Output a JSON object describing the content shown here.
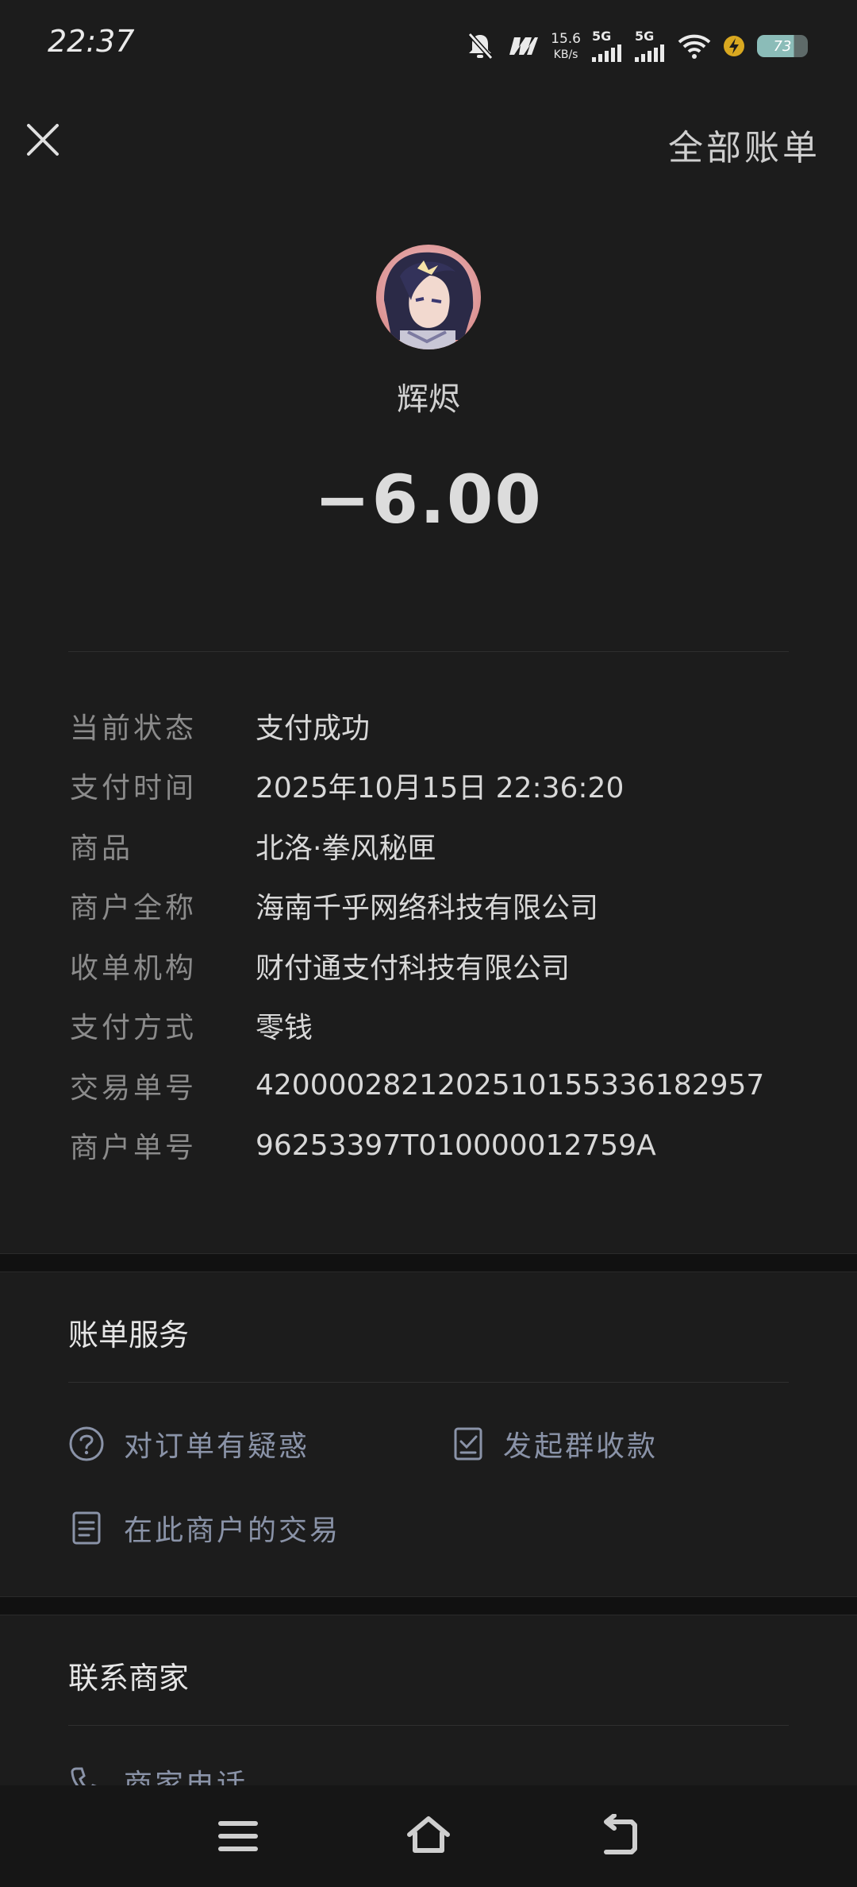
{
  "status_bar": {
    "time": "22:37",
    "net_speed_value": "15.6",
    "net_speed_unit": "KB/s",
    "sim1_label": "5G",
    "sim2_label": "5G",
    "battery_level": "73"
  },
  "header": {
    "all_bills_label": "全部账单",
    "merchant_name": "辉烬",
    "amount": "−6.00"
  },
  "details": [
    {
      "label": "当前状态",
      "value": "支付成功"
    },
    {
      "label": "支付时间",
      "value": "2025年10月15日 22:36:20"
    },
    {
      "label": "商品",
      "value": "北洛·拳风秘匣"
    },
    {
      "label": "商户全称",
      "value": "海南千乎网络科技有限公司"
    },
    {
      "label": "收单机构",
      "value": "财付通支付科技有限公司"
    },
    {
      "label": "支付方式",
      "value": "零钱"
    },
    {
      "label": "交易单号",
      "value": "4200002821202510155336182957"
    },
    {
      "label": "商户单号",
      "value": "96253397T010000012759A"
    }
  ],
  "bill_services": {
    "title": "账单服务",
    "items": [
      {
        "label": "对订单有疑惑",
        "icon": "question-circle-icon"
      },
      {
        "label": "发起群收款",
        "icon": "checklist-icon"
      },
      {
        "label": "在此商户的交易",
        "icon": "document-icon"
      }
    ]
  },
  "contact_merchant": {
    "title": "联系商家",
    "phone_label": "商家电话"
  },
  "colors": {
    "background": "#1c1c1c",
    "link": "#8a93a8"
  }
}
